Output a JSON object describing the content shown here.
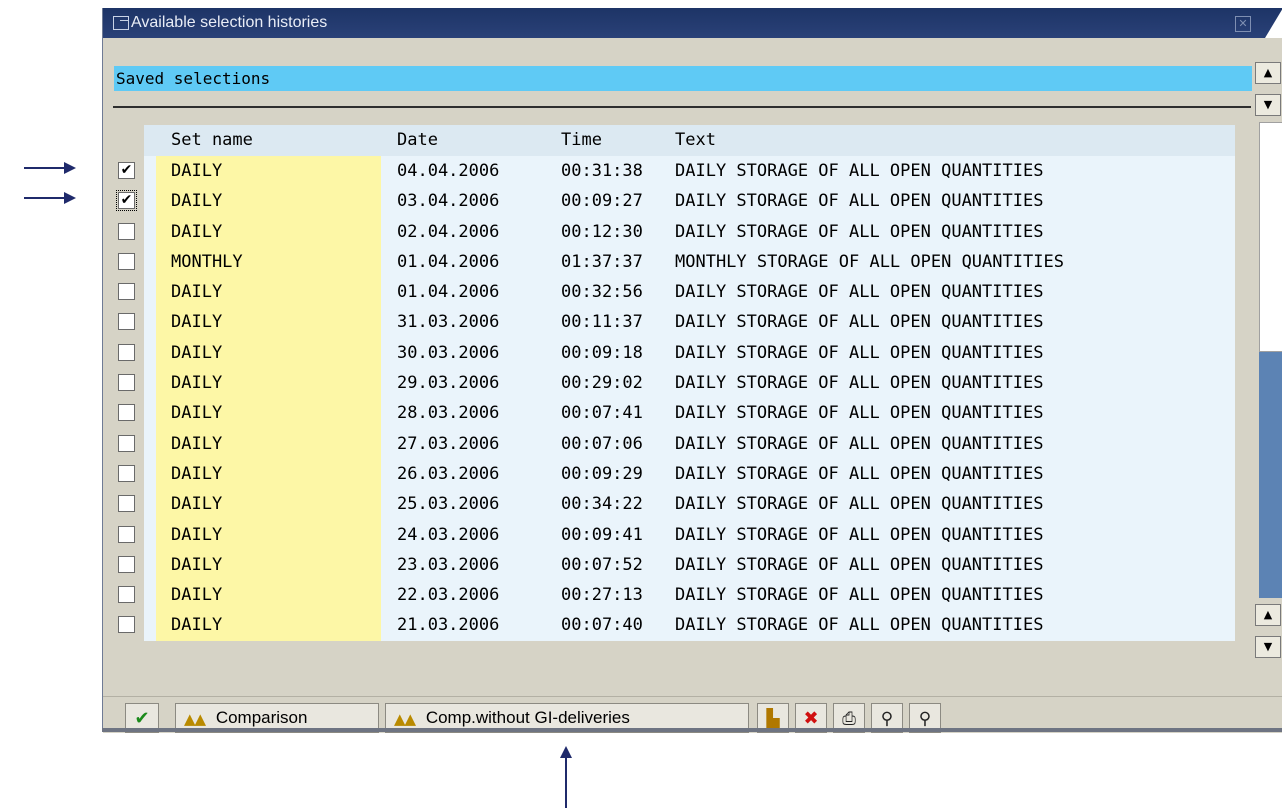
{
  "window": {
    "title": "Available selection histories"
  },
  "section": {
    "title": "Saved selections"
  },
  "table": {
    "headers": {
      "set_name": "Set name",
      "date": "Date",
      "time": "Time",
      "text": "Text"
    },
    "rows": [
      {
        "checked": true,
        "set": "DAILY",
        "date": "04.04.2006",
        "time": "00:31:38",
        "text": "DAILY STORAGE OF ALL OPEN QUANTITIES"
      },
      {
        "checked": true,
        "set": "DAILY",
        "date": "03.04.2006",
        "time": "00:09:27",
        "text": "DAILY STORAGE OF ALL OPEN QUANTITIES"
      },
      {
        "checked": false,
        "set": "DAILY",
        "date": "02.04.2006",
        "time": "00:12:30",
        "text": "DAILY STORAGE OF ALL OPEN QUANTITIES"
      },
      {
        "checked": false,
        "set": "MONTHLY",
        "date": "01.04.2006",
        "time": "01:37:37",
        "text": "MONTHLY STORAGE OF ALL OPEN QUANTITIES"
      },
      {
        "checked": false,
        "set": "DAILY",
        "date": "01.04.2006",
        "time": "00:32:56",
        "text": "DAILY STORAGE OF ALL OPEN QUANTITIES"
      },
      {
        "checked": false,
        "set": "DAILY",
        "date": "31.03.2006",
        "time": "00:11:37",
        "text": "DAILY STORAGE OF ALL OPEN QUANTITIES"
      },
      {
        "checked": false,
        "set": "DAILY",
        "date": "30.03.2006",
        "time": "00:09:18",
        "text": "DAILY STORAGE OF ALL OPEN QUANTITIES"
      },
      {
        "checked": false,
        "set": "DAILY",
        "date": "29.03.2006",
        "time": "00:29:02",
        "text": "DAILY STORAGE OF ALL OPEN QUANTITIES"
      },
      {
        "checked": false,
        "set": "DAILY",
        "date": "28.03.2006",
        "time": "00:07:41",
        "text": "DAILY STORAGE OF ALL OPEN QUANTITIES"
      },
      {
        "checked": false,
        "set": "DAILY",
        "date": "27.03.2006",
        "time": "00:07:06",
        "text": "DAILY STORAGE OF ALL OPEN QUANTITIES"
      },
      {
        "checked": false,
        "set": "DAILY",
        "date": "26.03.2006",
        "time": "00:09:29",
        "text": "DAILY STORAGE OF ALL OPEN QUANTITIES"
      },
      {
        "checked": false,
        "set": "DAILY",
        "date": "25.03.2006",
        "time": "00:34:22",
        "text": "DAILY STORAGE OF ALL OPEN QUANTITIES"
      },
      {
        "checked": false,
        "set": "DAILY",
        "date": "24.03.2006",
        "time": "00:09:41",
        "text": "DAILY STORAGE OF ALL OPEN QUANTITIES"
      },
      {
        "checked": false,
        "set": "DAILY",
        "date": "23.03.2006",
        "time": "00:07:52",
        "text": "DAILY STORAGE OF ALL OPEN QUANTITIES"
      },
      {
        "checked": false,
        "set": "DAILY",
        "date": "22.03.2006",
        "time": "00:27:13",
        "text": "DAILY STORAGE OF ALL OPEN QUANTITIES"
      },
      {
        "checked": false,
        "set": "DAILY",
        "date": "21.03.2006",
        "time": "00:07:40",
        "text": "DAILY STORAGE OF ALL OPEN QUANTITIES"
      }
    ]
  },
  "toolbar": {
    "continue_icon": "checkmark-icon",
    "comparison_label": "Comparison",
    "comp_without_label": "Comp.without GI-deliveries",
    "icons": [
      "layout-icon",
      "delete-icon",
      "print-icon",
      "find-icon",
      "find-next-icon"
    ]
  },
  "colors": {
    "titlebar": "#1d3466",
    "section_header": "#5fcaf5",
    "set_name_column": "#fdf7a6",
    "row_background": "#eaf4fb",
    "dialog_background": "#d6d3c6",
    "annotation_arrow": "#1f2a6b"
  }
}
